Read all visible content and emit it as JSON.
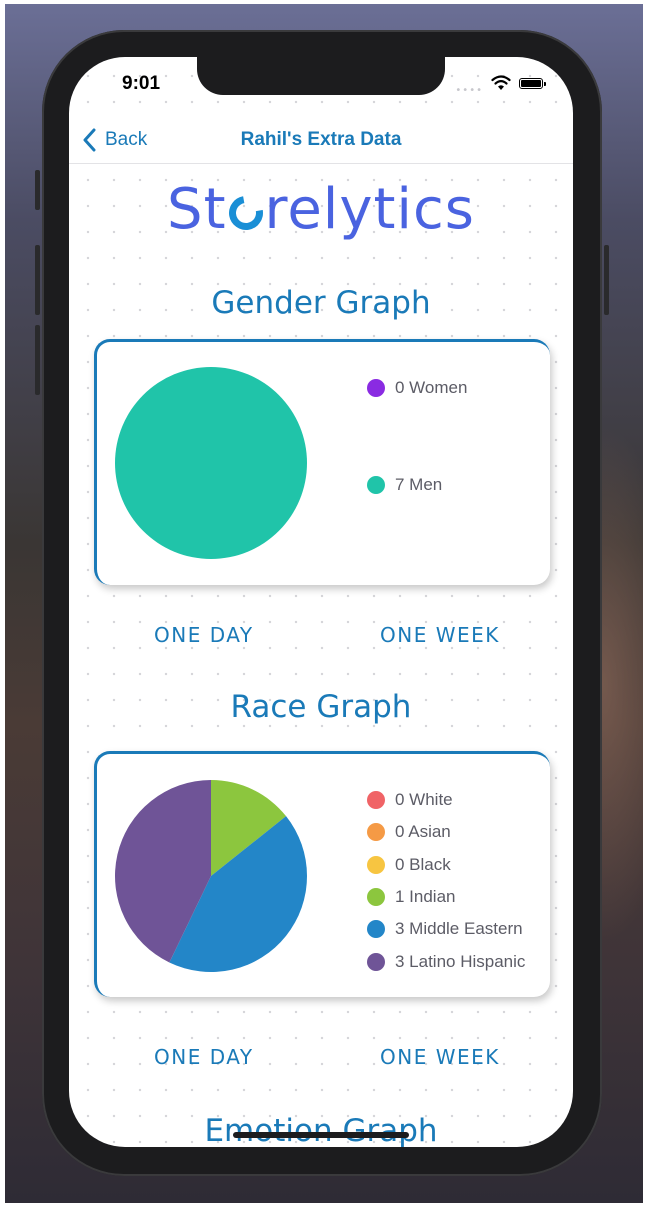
{
  "status_bar": {
    "time": "9:01"
  },
  "navbar": {
    "back_label": "Back",
    "title": "Rahil's Extra Data"
  },
  "logo": {
    "text_before": "St",
    "text_after": "relytics"
  },
  "gender_section": {
    "title": "Gender Graph",
    "range_buttons": [
      "ONE DAY",
      "ONE WEEK"
    ],
    "legend": [
      {
        "label": "0 Women",
        "color": "#8a2be2"
      },
      {
        "label": "7 Men",
        "color": "#20c4a9"
      }
    ]
  },
  "race_section": {
    "title": "Race Graph",
    "range_buttons": [
      "ONE DAY",
      "ONE WEEK"
    ],
    "legend": [
      {
        "label": "0 White",
        "color": "#f06366"
      },
      {
        "label": "0 Asian",
        "color": "#f59a45"
      },
      {
        "label": "0 Black",
        "color": "#f7c541"
      },
      {
        "label": "1 Indian",
        "color": "#8cc63e"
      },
      {
        "label": "3 Middle Eastern",
        "color": "#2386c8"
      },
      {
        "label": "3 Latino Hispanic",
        "color": "#6f5497"
      }
    ]
  },
  "emotion_section": {
    "title": "Emotion Graph"
  },
  "chart_data": [
    {
      "type": "pie",
      "title": "Gender Graph",
      "categories": [
        "Women",
        "Men"
      ],
      "values": [
        0,
        7
      ],
      "colors": [
        "#8a2be2",
        "#20c4a9"
      ]
    },
    {
      "type": "pie",
      "title": "Race Graph",
      "categories": [
        "White",
        "Asian",
        "Black",
        "Indian",
        "Middle Eastern",
        "Latino Hispanic"
      ],
      "values": [
        0,
        0,
        0,
        1,
        3,
        3
      ],
      "colors": [
        "#f06366",
        "#f59a45",
        "#f7c541",
        "#8cc63e",
        "#2386c8",
        "#6f5497"
      ]
    }
  ]
}
